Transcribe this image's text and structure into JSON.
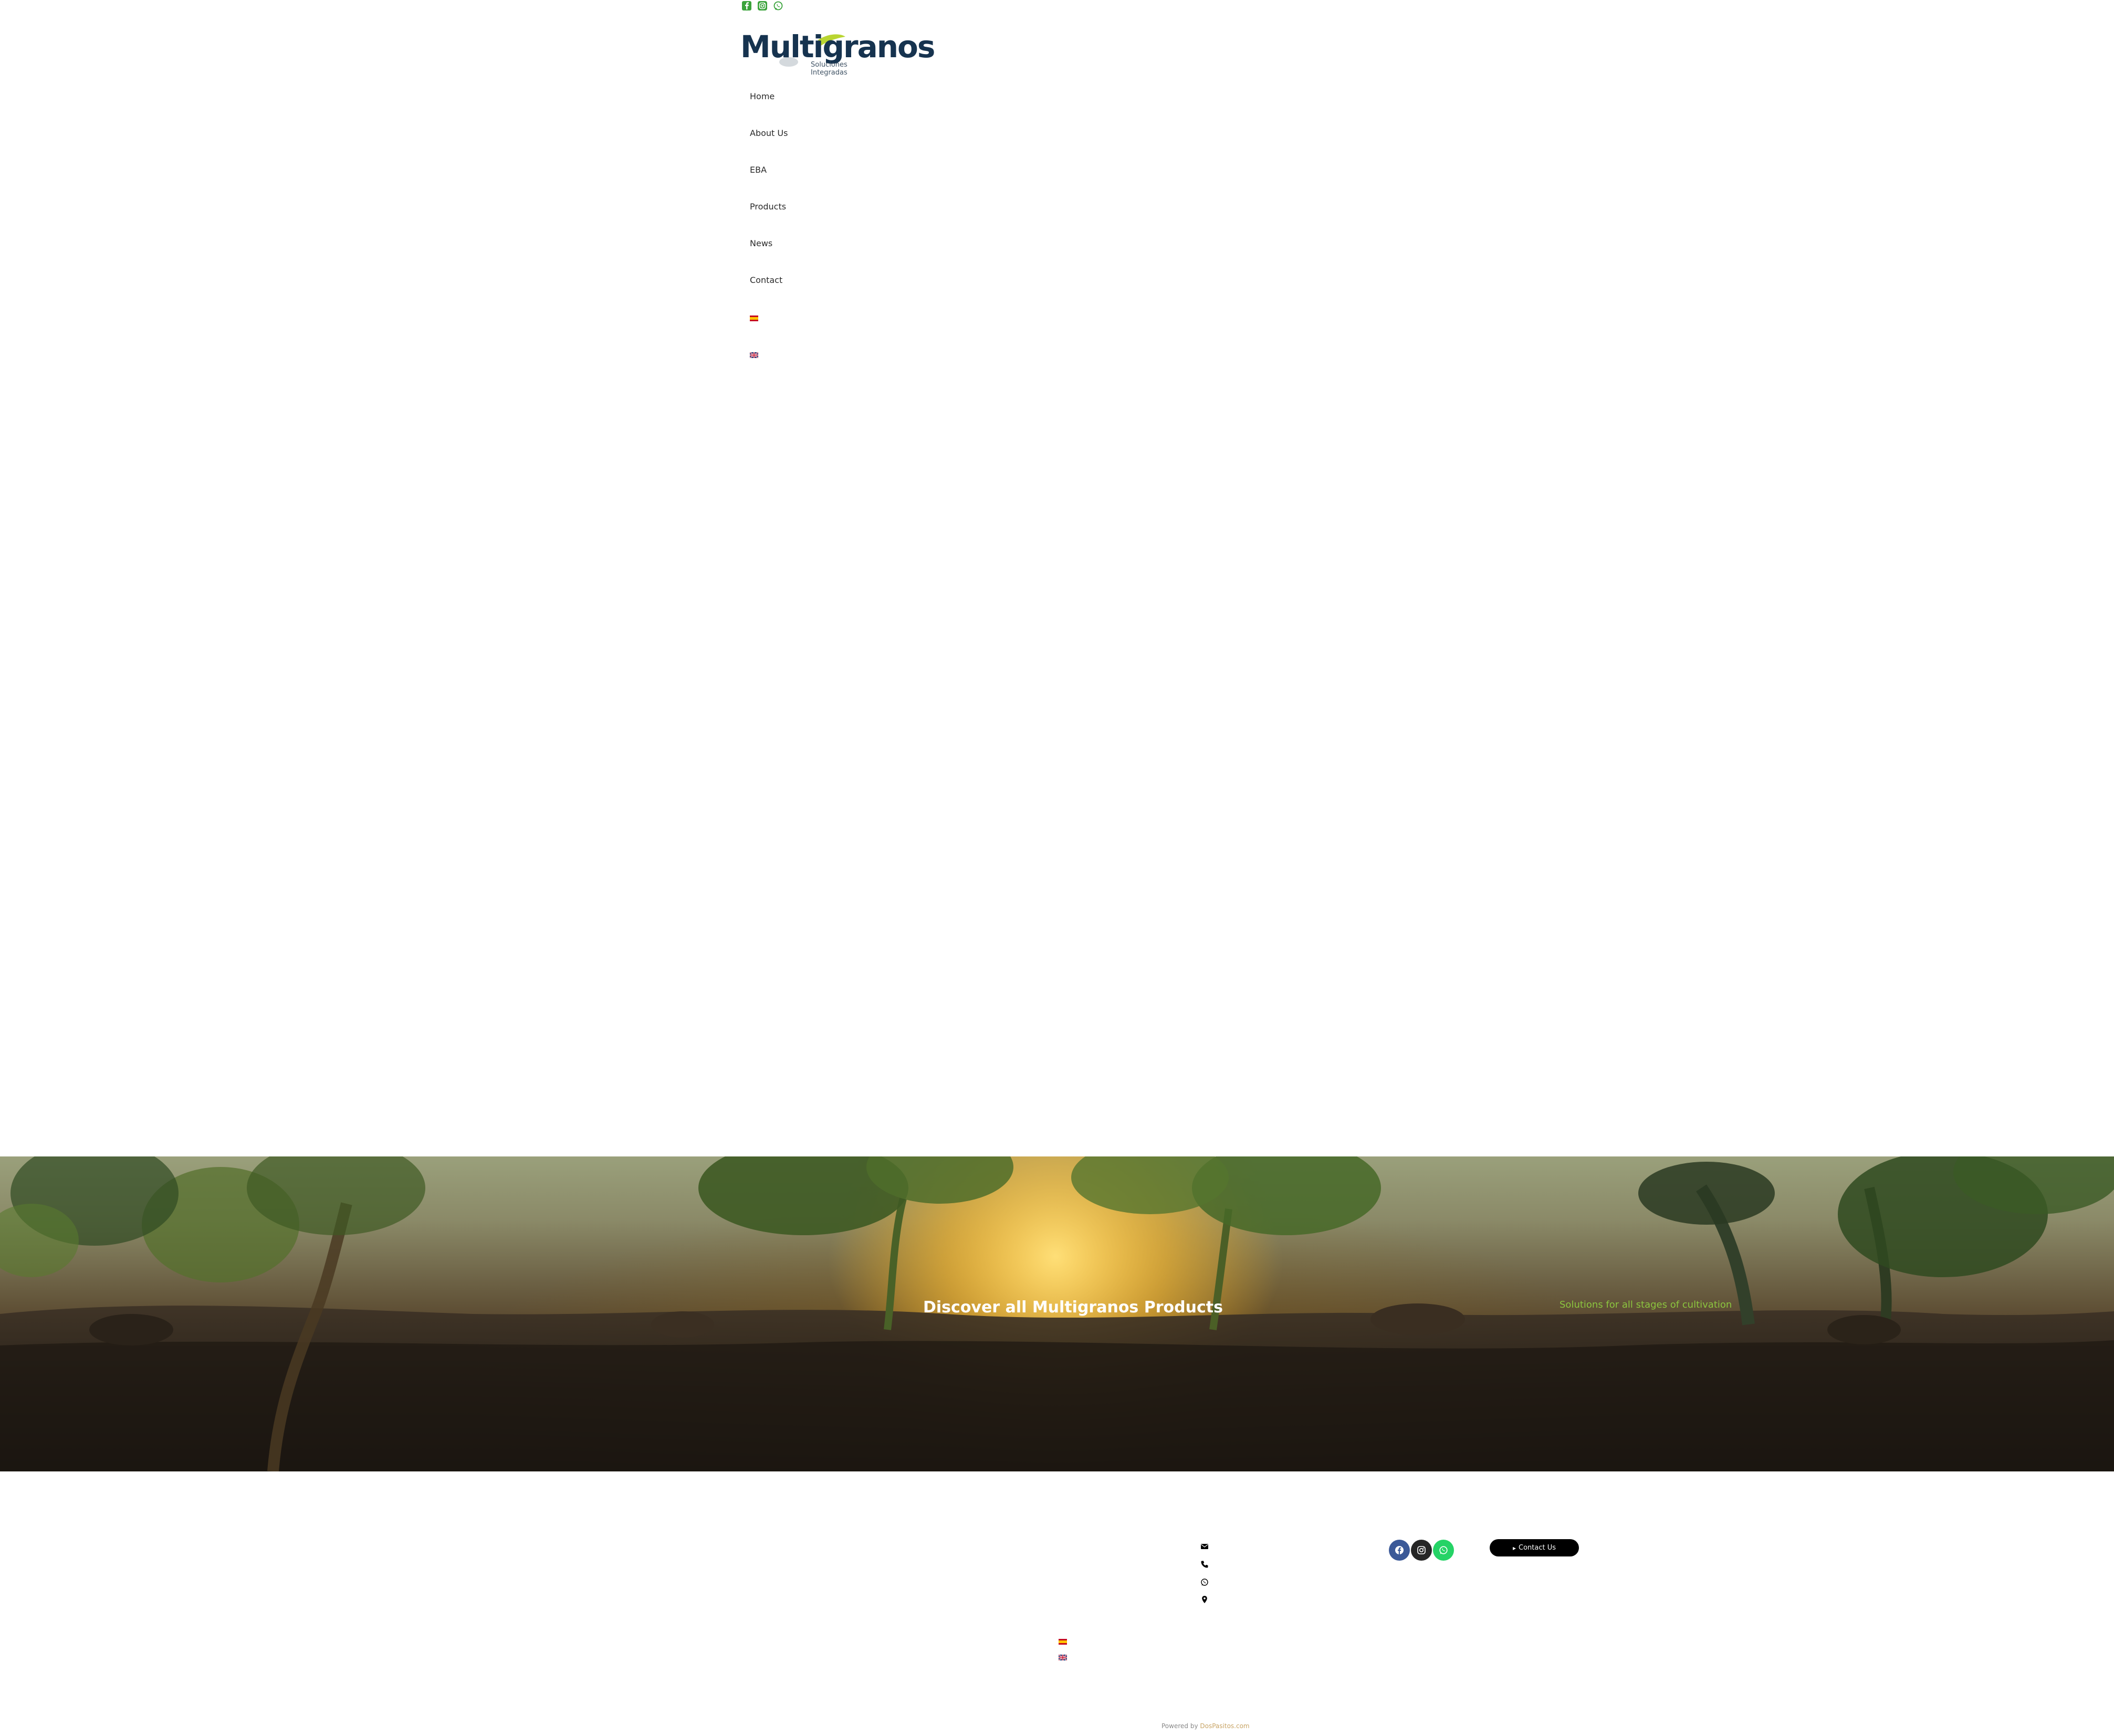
{
  "header": {
    "social_icons": [
      "facebook-icon",
      "instagram-icon",
      "whatsapp-icon"
    ],
    "logo": {
      "wordmark": "Multigranos",
      "tagline": "Soluciones Integradas"
    }
  },
  "nav": {
    "items": [
      {
        "label": "Home"
      },
      {
        "label": "About Us"
      },
      {
        "label": "EBA"
      },
      {
        "label": "Products"
      },
      {
        "label": "News"
      },
      {
        "label": "Contact"
      }
    ],
    "languages": [
      "spanish-flag-icon",
      "uk-flag-icon"
    ]
  },
  "hero": {
    "title": "Discover all Multigranos Products",
    "subtitle": "Solutions for all stages of cultivation"
  },
  "footer": {
    "contact_icons": [
      "mail-icon",
      "phone-icon",
      "whatsapp-icon",
      "location-pin-icon"
    ],
    "social_icons": [
      "facebook-icon",
      "instagram-icon",
      "whatsapp-icon"
    ],
    "contact_button": "Contact Us",
    "languages": [
      "spanish-flag-icon",
      "uk-flag-icon"
    ],
    "powered_by": "Powered by",
    "powered_link": "DosPasitos.com"
  },
  "colors": {
    "brand_navy": "#16334f",
    "brand_green": "#8cc63f",
    "social_green": "#3aa33b",
    "facebook_blue": "#3b5998",
    "whatsapp_green": "#25d366",
    "button_black": "#000000"
  }
}
